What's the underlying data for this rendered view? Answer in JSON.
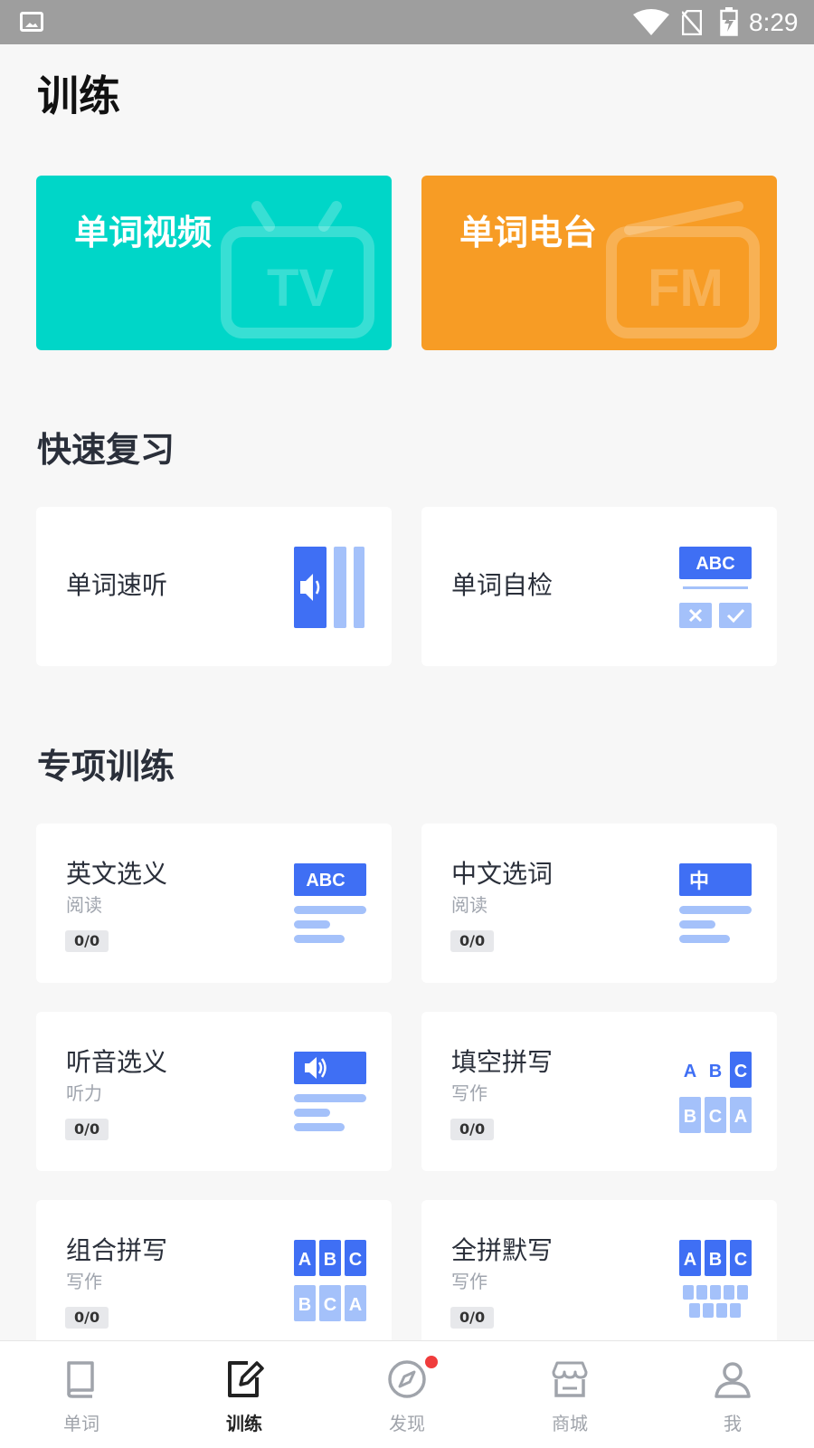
{
  "status_bar": {
    "time": "8:29"
  },
  "page_title": "训练",
  "hero": {
    "video": {
      "label": "单词视频",
      "icon_text": "TV",
      "color": "#00d6c8"
    },
    "radio": {
      "label": "单词电台",
      "icon_text": "FM",
      "color": "#f79c25"
    }
  },
  "quick_review": {
    "title": "快速复习",
    "items": [
      {
        "label": "单词速听",
        "icon": "speaker-bars-icon"
      },
      {
        "label": "单词自检",
        "icon": "abc-check-icon",
        "icon_text": "ABC"
      }
    ]
  },
  "special_training": {
    "title": "专项训练",
    "items": [
      {
        "label": "英文选义",
        "category": "阅读",
        "progress": "0/0",
        "icon_text": "ABC"
      },
      {
        "label": "中文选词",
        "category": "阅读",
        "progress": "0/0",
        "icon_text": "中"
      },
      {
        "label": "听音选义",
        "category": "听力",
        "progress": "0/0",
        "icon": "speaker-lines-icon"
      },
      {
        "label": "填空拼写",
        "category": "写作",
        "progress": "0/0",
        "icon_letters_top": [
          "A",
          "B",
          "C"
        ],
        "icon_letters_bottom": [
          "B",
          "C",
          "A"
        ]
      },
      {
        "label": "组合拼写",
        "category": "写作",
        "progress": "0/0",
        "icon_letters_top": [
          "A",
          "B",
          "C"
        ],
        "icon_letters_bottom": [
          "B",
          "C",
          "A"
        ]
      },
      {
        "label": "全拼默写",
        "category": "写作",
        "progress": "0/0",
        "icon_letters_top": [
          "A",
          "B",
          "C"
        ]
      }
    ]
  },
  "tabbar": {
    "tabs": [
      {
        "label": "单词",
        "icon": "book-icon",
        "active": false
      },
      {
        "label": "训练",
        "icon": "edit-icon",
        "active": true
      },
      {
        "label": "发现",
        "icon": "compass-icon",
        "active": false,
        "badge_dot": true
      },
      {
        "label": "商城",
        "icon": "store-icon",
        "active": false
      },
      {
        "label": "我",
        "icon": "person-icon",
        "active": false
      }
    ]
  },
  "colors": {
    "accent_blue": "#3f6ff4",
    "light_blue": "#a4c1fa",
    "teal": "#00d6c8",
    "orange": "#f79c25",
    "badge_dot": "#f03c3c"
  }
}
